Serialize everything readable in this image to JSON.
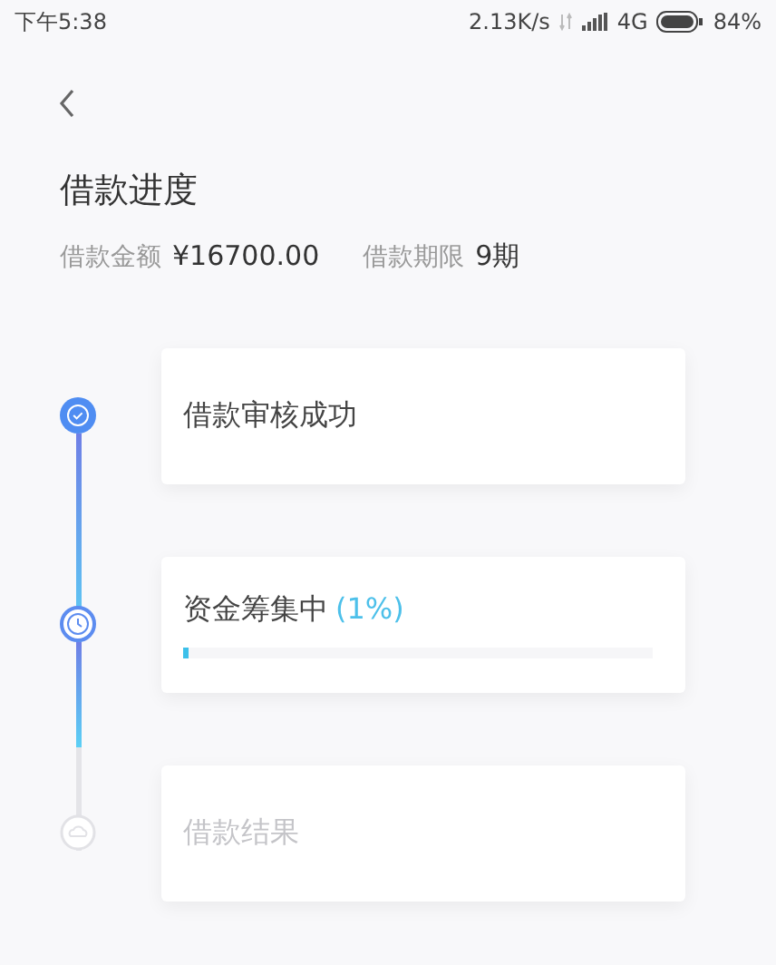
{
  "status_bar": {
    "time": "下午5:38",
    "speed": "2.13K/s",
    "network": "4G",
    "battery": "84%"
  },
  "title": "借款进度",
  "summary": [
    {
      "label": "借款金额",
      "value": "¥16700.00"
    },
    {
      "label": "借款期限",
      "value": "9期"
    }
  ],
  "steps": [
    {
      "kind": "done",
      "label": "借款审核成功"
    },
    {
      "kind": "active",
      "label": "资金筹集中",
      "percent": "(1%)",
      "level": 0.01
    },
    {
      "kind": "pending",
      "label": "借款结果"
    }
  ]
}
